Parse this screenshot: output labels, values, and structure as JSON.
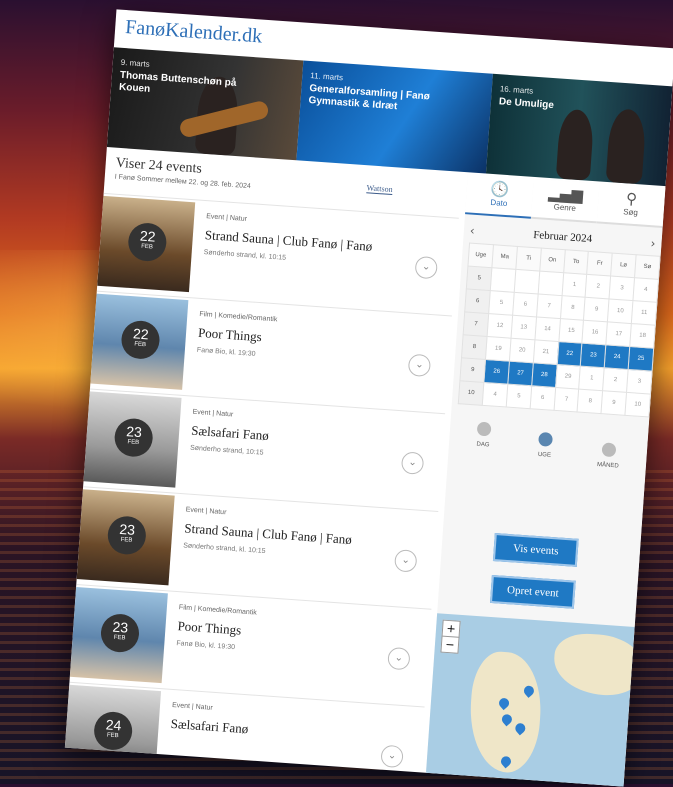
{
  "site": {
    "logo": "FanøKalender.dk"
  },
  "banner": [
    {
      "date": "9. marts",
      "title": "Thomas Buttenschøn på Kouen"
    },
    {
      "date": "11. marts",
      "title": "Generalforsamling | Fanø Gymnastik & Idræt"
    },
    {
      "date": "16. marts",
      "title": "De Umulige"
    }
  ],
  "list": {
    "count_label": "Viser 24 events",
    "subtitle": "I Fanø Sommer melleм 22. og 28. feb. 2024",
    "sponsor": "Wattson"
  },
  "events": [
    {
      "day": "22",
      "month": "FEB",
      "category": "Event | Natur",
      "title": "Strand Sauna | Club Fanø | Fanø",
      "location": "Sønderho strand, kl. 10:15",
      "thumb": "sauna"
    },
    {
      "day": "22",
      "month": "FEB",
      "category": "Film | Komedie/Romantik",
      "title": "Poor Things",
      "location": "Fanø Bio, kl. 19:30",
      "thumb": "poor"
    },
    {
      "day": "23",
      "month": "FEB",
      "category": "Event | Natur",
      "title": "Sælsafari Fanø",
      "location": "Sønderho strand, 10:15",
      "thumb": "sals"
    },
    {
      "day": "23",
      "month": "FEB",
      "category": "Event | Natur",
      "title": "Strand Sauna | Club Fanø | Fanø",
      "location": "Sønderho strand, kl. 10:15",
      "thumb": "sauna"
    },
    {
      "day": "23",
      "month": "FEB",
      "category": "Film | Komedie/Romantik",
      "title": "Poor Things",
      "location": "Fanø Bio, kl. 19:30",
      "thumb": "poor"
    },
    {
      "day": "24",
      "month": "FEB",
      "category": "Event | Natur",
      "title": "Sælsafari Fanø",
      "location": "",
      "thumb": "sals"
    }
  ],
  "tabs": [
    {
      "label": "Dato",
      "icon": "clock-icon",
      "glyph": "🕓"
    },
    {
      "label": "Genre",
      "icon": "bars-icon",
      "glyph": "▂▄▆"
    },
    {
      "label": "Søg",
      "icon": "search-icon",
      "glyph": "⚲"
    }
  ],
  "calendar": {
    "month": "Februar 2024",
    "prev": "‹",
    "next": "›",
    "headers": [
      "Uge",
      "Ma",
      "Ti",
      "On",
      "To",
      "Fr",
      "Lø",
      "Sø"
    ],
    "rows": [
      [
        "5",
        "",
        "",
        "",
        "1",
        "2",
        "3",
        "4"
      ],
      [
        "6",
        "5",
        "6",
        "7",
        "8",
        "9",
        "10",
        "11"
      ],
      [
        "7",
        "12",
        "13",
        "14",
        "15",
        "16",
        "17",
        "18"
      ],
      [
        "8",
        "19",
        "20",
        "21",
        "22",
        "23",
        "24",
        "25"
      ],
      [
        "9",
        "26",
        "27",
        "28",
        "29",
        "1",
        "2",
        "3"
      ],
      [
        "10",
        "4",
        "5",
        "6",
        "7",
        "8",
        "9",
        "10"
      ]
    ],
    "selected": [
      [
        3,
        4
      ],
      [
        3,
        5
      ],
      [
        3,
        6
      ],
      [
        3,
        7
      ],
      [
        4,
        1
      ],
      [
        4,
        2
      ],
      [
        4,
        3
      ]
    ]
  },
  "modes": [
    {
      "label": "DAG",
      "active": false
    },
    {
      "label": "UGE",
      "active": true
    },
    {
      "label": "MÅNED",
      "active": false
    }
  ],
  "buttons": {
    "show": "Vis events",
    "create": "Opret event"
  },
  "map": {
    "zoom_in": "+",
    "zoom_out": "−"
  }
}
